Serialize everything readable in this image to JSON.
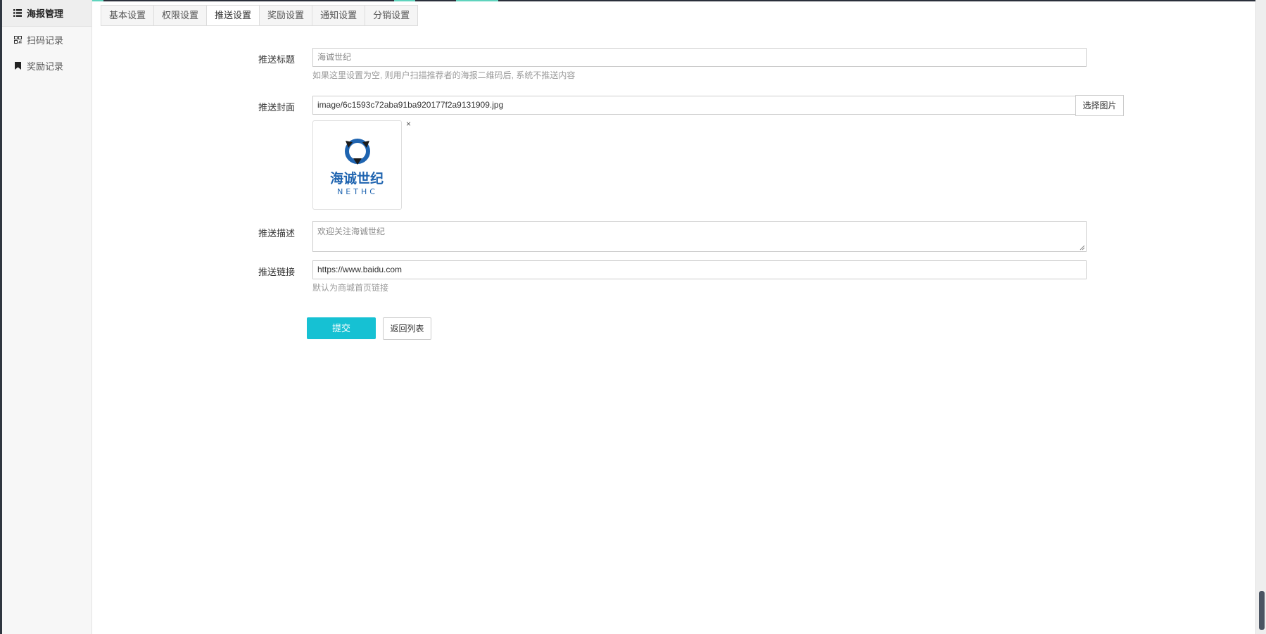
{
  "sidebar": {
    "items": [
      {
        "label": "海报管理",
        "icon": "list-icon",
        "active": true
      },
      {
        "label": "扫码记录",
        "icon": "qrcode-icon",
        "active": false
      },
      {
        "label": "奖励记录",
        "icon": "bookmark-icon",
        "active": false
      }
    ]
  },
  "tabs": [
    {
      "label": "基本设置",
      "active": false
    },
    {
      "label": "权限设置",
      "active": false
    },
    {
      "label": "推送设置",
      "active": true
    },
    {
      "label": "奖励设置",
      "active": false
    },
    {
      "label": "通知设置",
      "active": false
    },
    {
      "label": "分销设置",
      "active": false
    }
  ],
  "form": {
    "title": {
      "label": "推送标题",
      "placeholder": "海诚世纪",
      "help": "如果这里设置为空, 则用户扫描推荐者的海报二维码后, 系统不推送内容"
    },
    "cover": {
      "label": "推送封面",
      "value": "image/6c1593c72aba91ba920177f2a9131909.jpg",
      "select_button": "选择图片",
      "remove_symbol": "×",
      "logo_text_cn": "海诚世纪",
      "logo_text_en": "NETHC"
    },
    "description": {
      "label": "推送描述",
      "placeholder": "欢迎关注海诚世纪"
    },
    "link": {
      "label": "推送链接",
      "value": "https://www.baidu.com",
      "help": "默认为商城首页链接"
    },
    "submit_label": "提交",
    "back_label": "返回列表"
  },
  "colors": {
    "primary_button": "#16c1d3",
    "logo_blue": "#1f64b0",
    "logo_dark": "#1a1a1a"
  }
}
